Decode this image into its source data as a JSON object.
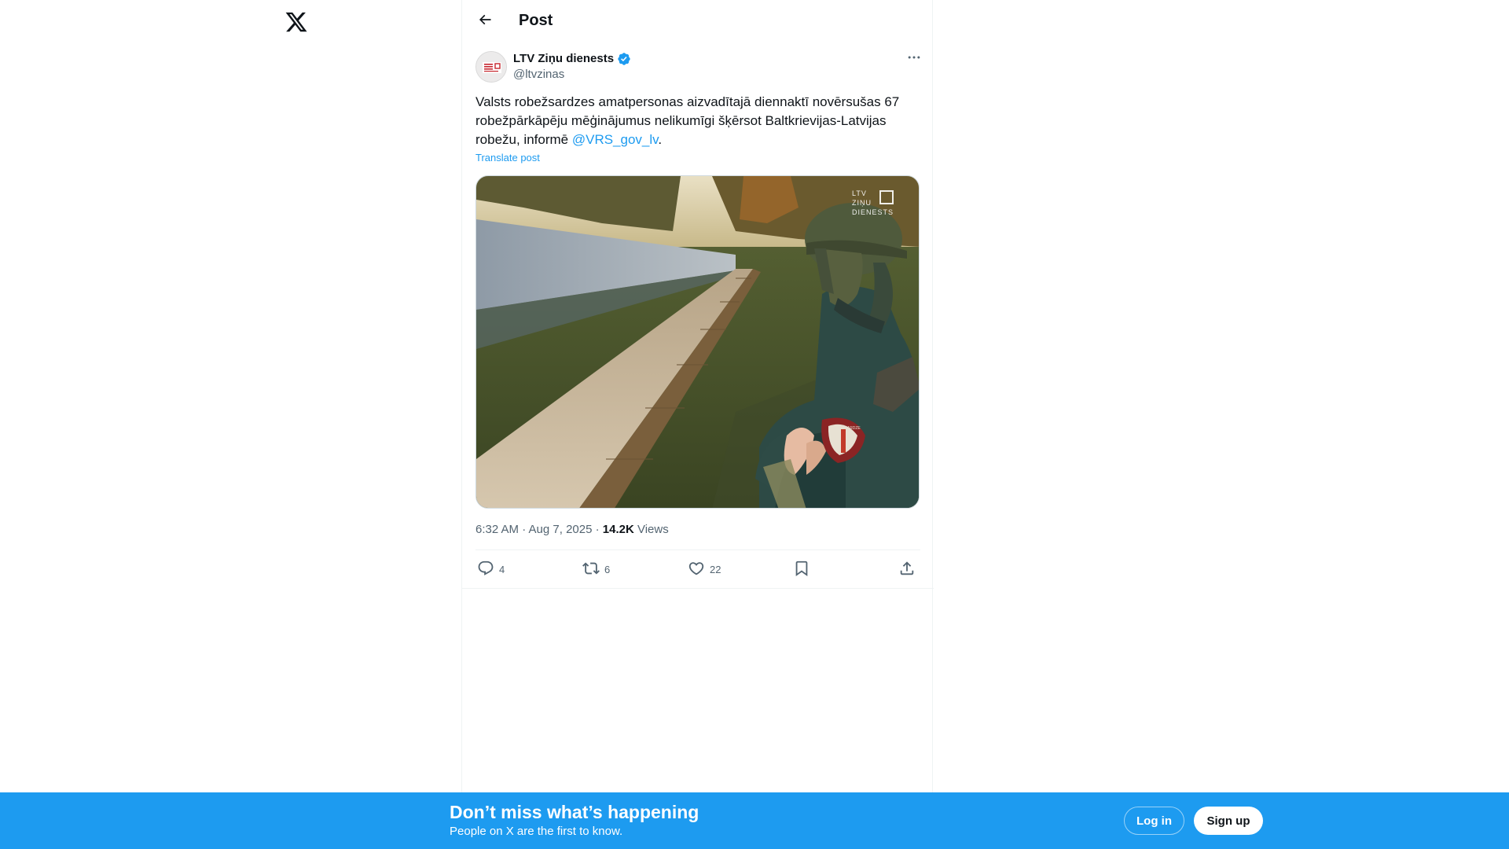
{
  "header": {
    "title": "Post"
  },
  "post": {
    "author_name": "LTV Ziņu dienests",
    "author_handle": "@ltvzinas",
    "text_before": "Valsts robežsardzes amatpersonas aizvadītajā diennaktī novērsušas 67 robežpārkāpēju mēģinājumus nelikumīgi šķērsot Baltkrievijas-Latvijas robežu, informē ",
    "mention": "@VRS_gov_lv",
    "text_after": ".",
    "translate_label": "Translate post",
    "media_watermark": [
      "LTV",
      "ZIŅU",
      "DIENESTS"
    ],
    "timestamp": "6:32 AM · Aug 7, 2025",
    "separator": " · ",
    "views_count": "14.2K",
    "views_label": " Views",
    "actions": {
      "replies": "4",
      "reposts": "6",
      "likes": "22"
    }
  },
  "banner": {
    "title": "Don’t miss what’s happening",
    "subtitle": "People on X are the first to know.",
    "login_label": "Log in",
    "signup_label": "Sign up"
  },
  "colors": {
    "accent": "#1d9bf0",
    "text": "#0f1419",
    "secondary_text": "#536471",
    "border": "#eff3f4"
  },
  "icons": [
    "x-logo-icon",
    "back-arrow-icon",
    "verified-badge-icon",
    "more-icon",
    "reply-icon",
    "repost-icon",
    "like-icon",
    "bookmark-icon",
    "share-icon"
  ]
}
